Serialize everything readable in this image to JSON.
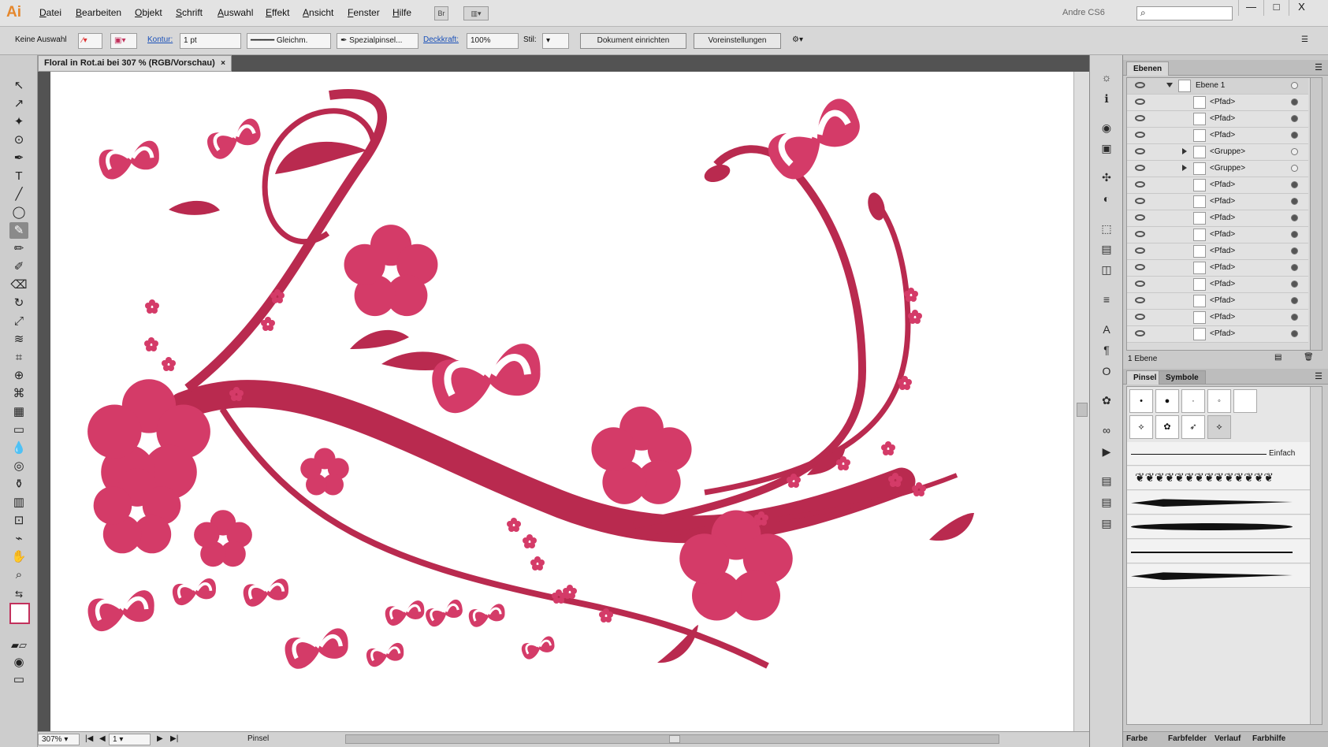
{
  "app": {
    "logo": "Ai",
    "workspace_user": "Andre CS6",
    "search_placeholder": ""
  },
  "menu": [
    "Datei",
    "Bearbeiten",
    "Objekt",
    "Schrift",
    "Auswahl",
    "Effekt",
    "Ansicht",
    "Fenster",
    "Hilfe"
  ],
  "window": {
    "br_label": "Br",
    "minimize": "—",
    "maximize": "□",
    "close": "X"
  },
  "control": {
    "selection": "Keine Auswahl",
    "stroke_label": "Kontur:",
    "stroke_value": "1 pt",
    "line_profile": "Gleichm.",
    "brush": "Spezialpinsel...",
    "opacity_label": "Deckkraft:",
    "opacity_value": "100%",
    "style_label": "Stil:",
    "document_setup": "Dokument einrichten",
    "preferences": "Voreinstellungen"
  },
  "document": {
    "tab_title": "Floral in Rot.ai bei 307 % (RGB/Vorschau)",
    "tab_close": "×"
  },
  "status": {
    "zoom": "307%",
    "page": "1",
    "tool": "Pinsel"
  },
  "layers": {
    "tab": "Ebenen",
    "footer": "1 Ebene",
    "items": [
      "Ebene 1",
      "<Pfad>",
      "<Pfad>",
      "<Pfad>",
      "<Gruppe>",
      "<Gruppe>",
      "<Pfad>",
      "<Pfad>",
      "<Pfad>",
      "<Pfad>",
      "<Pfad>",
      "<Pfad>",
      "<Pfad>",
      "<Pfad>",
      "<Pfad>",
      "<Pfad>",
      "<Pfad>",
      "<Pfad>"
    ]
  },
  "brushes": {
    "tab": "Pinsel",
    "tab2": "Symbole",
    "first_brush": "Einfach"
  },
  "bottom_tabs": [
    "Farbe",
    "Farbfelder",
    "Verlauf",
    "Farbhilfe"
  ],
  "colors": {
    "primary": "#b92a4f",
    "flower": "#d43b68",
    "dark": "#9f1d3c",
    "pale": "#f2a1bb"
  }
}
